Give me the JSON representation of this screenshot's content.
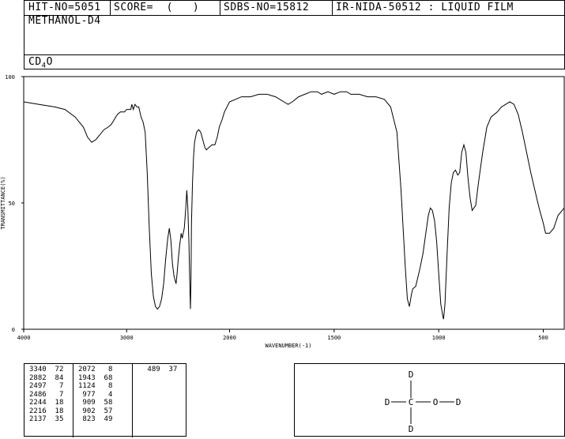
{
  "header": {
    "hit_no": "HIT-NO=5051",
    "score": "SCORE=  (   )",
    "sdbs_no": "SDBS-NO=15812",
    "method": "IR-NIDA-50512 : LIQUID FILM"
  },
  "compound": {
    "name": "METHANOL-D4",
    "formula_main": "CD",
    "formula_sub": "4",
    "formula_tail": "O"
  },
  "chart_data": {
    "type": "line",
    "title": "",
    "xlabel": "WAVENUMBER(-1)",
    "ylabel": "TRANSMITTANCE(%)",
    "xlim": [
      4000,
      400
    ],
    "ylim": [
      0,
      100
    ],
    "x_ticks": [
      4000,
      3000,
      2000,
      1500,
      1000,
      500
    ],
    "x_tick_labels": [
      "4000",
      "3000",
      "2000",
      "1500",
      "1000",
      "500"
    ],
    "y_ticks": [
      0,
      50,
      100
    ],
    "y_tick_labels": [
      "0",
      "50",
      "100"
    ],
    "series": [
      {
        "color": "#000000",
        "points": [
          [
            4000,
            90
          ],
          [
            3850,
            89
          ],
          [
            3700,
            88
          ],
          [
            3600,
            87
          ],
          [
            3500,
            84
          ],
          [
            3420,
            80
          ],
          [
            3380,
            76
          ],
          [
            3340,
            74
          ],
          [
            3300,
            75
          ],
          [
            3260,
            77
          ],
          [
            3220,
            79
          ],
          [
            3180,
            80
          ],
          [
            3150,
            81
          ],
          [
            3120,
            83
          ],
          [
            3090,
            85
          ],
          [
            3060,
            86
          ],
          [
            3020,
            86
          ],
          [
            3000,
            87
          ],
          [
            2960,
            87
          ],
          [
            2950,
            89
          ],
          [
            2935,
            87
          ],
          [
            2920,
            89
          ],
          [
            2900,
            88
          ],
          [
            2882,
            88
          ],
          [
            2860,
            84
          ],
          [
            2840,
            82
          ],
          [
            2820,
            78
          ],
          [
            2800,
            62
          ],
          [
            2780,
            40
          ],
          [
            2760,
            22
          ],
          [
            2740,
            13
          ],
          [
            2720,
            9
          ],
          [
            2700,
            8
          ],
          [
            2680,
            9
          ],
          [
            2660,
            12
          ],
          [
            2640,
            18
          ],
          [
            2620,
            28
          ],
          [
            2600,
            36
          ],
          [
            2585,
            40
          ],
          [
            2570,
            35
          ],
          [
            2555,
            26
          ],
          [
            2540,
            21
          ],
          [
            2520,
            18
          ],
          [
            2510,
            22
          ],
          [
            2500,
            27
          ],
          [
            2485,
            33
          ],
          [
            2470,
            38
          ],
          [
            2460,
            36
          ],
          [
            2440,
            40
          ],
          [
            2425,
            48
          ],
          [
            2415,
            55
          ],
          [
            2405,
            48
          ],
          [
            2395,
            34
          ],
          [
            2385,
            15
          ],
          [
            2380,
            8
          ],
          [
            2375,
            20
          ],
          [
            2370,
            42
          ],
          [
            2360,
            58
          ],
          [
            2350,
            68
          ],
          [
            2340,
            74
          ],
          [
            2320,
            78
          ],
          [
            2300,
            79
          ],
          [
            2280,
            78
          ],
          [
            2260,
            75
          ],
          [
            2240,
            72
          ],
          [
            2225,
            71
          ],
          [
            2200,
            72
          ],
          [
            2170,
            73
          ],
          [
            2143,
            73
          ],
          [
            2120,
            76
          ],
          [
            2100,
            80
          ],
          [
            2072,
            83
          ],
          [
            2050,
            86
          ],
          [
            2000,
            90
          ],
          [
            1943,
            92
          ],
          [
            1900,
            92
          ],
          [
            1860,
            93
          ],
          [
            1820,
            93
          ],
          [
            1780,
            92
          ],
          [
            1740,
            90
          ],
          [
            1720,
            89
          ],
          [
            1700,
            90
          ],
          [
            1670,
            92
          ],
          [
            1640,
            93
          ],
          [
            1610,
            94
          ],
          [
            1580,
            94
          ],
          [
            1560,
            93
          ],
          [
            1530,
            94
          ],
          [
            1500,
            93
          ],
          [
            1470,
            94
          ],
          [
            1440,
            94
          ],
          [
            1420,
            93
          ],
          [
            1400,
            93
          ],
          [
            1380,
            93
          ],
          [
            1340,
            92
          ],
          [
            1300,
            92
          ],
          [
            1260,
            91
          ],
          [
            1230,
            88
          ],
          [
            1200,
            78
          ],
          [
            1180,
            55
          ],
          [
            1160,
            25
          ],
          [
            1150,
            12
          ],
          [
            1140,
            9
          ],
          [
            1130,
            14
          ],
          [
            1124,
            16
          ],
          [
            1110,
            17
          ],
          [
            1090,
            24
          ],
          [
            1075,
            30
          ],
          [
            1060,
            39
          ],
          [
            1050,
            45
          ],
          [
            1040,
            48
          ],
          [
            1030,
            47
          ],
          [
            1020,
            43
          ],
          [
            1010,
            35
          ],
          [
            1000,
            22
          ],
          [
            990,
            10
          ],
          [
            980,
            5
          ],
          [
            977,
            4
          ],
          [
            970,
            10
          ],
          [
            960,
            30
          ],
          [
            950,
            48
          ],
          [
            940,
            58
          ],
          [
            930,
            62
          ],
          [
            920,
            63
          ],
          [
            909,
            61
          ],
          [
            900,
            62
          ],
          [
            890,
            70
          ],
          [
            880,
            73
          ],
          [
            870,
            70
          ],
          [
            860,
            60
          ],
          [
            850,
            52
          ],
          [
            840,
            47
          ],
          [
            823,
            49
          ],
          [
            810,
            58
          ],
          [
            790,
            70
          ],
          [
            770,
            80
          ],
          [
            750,
            84
          ],
          [
            720,
            86
          ],
          [
            700,
            88
          ],
          [
            680,
            89
          ],
          [
            660,
            90
          ],
          [
            640,
            89
          ],
          [
            620,
            85
          ],
          [
            600,
            78
          ],
          [
            580,
            70
          ],
          [
            560,
            62
          ],
          [
            540,
            55
          ],
          [
            520,
            48
          ],
          [
            500,
            42
          ],
          [
            489,
            38
          ],
          [
            470,
            38
          ],
          [
            450,
            40
          ],
          [
            430,
            45
          ],
          [
            400,
            48
          ]
        ]
      }
    ]
  },
  "peak_table": {
    "columns": [
      [
        [
          "3340",
          "72"
        ],
        [
          "2882",
          "84"
        ],
        [
          "2497",
          "7"
        ],
        [
          "2486",
          "7"
        ],
        [
          "2244",
          "18"
        ],
        [
          "2216",
          "18"
        ],
        [
          "2137",
          "35"
        ]
      ],
      [
        [
          "2072",
          "8"
        ],
        [
          "1943",
          "68"
        ],
        [
          "1124",
          "8"
        ],
        [
          "977",
          "4"
        ],
        [
          "909",
          "58"
        ],
        [
          "902",
          "57"
        ],
        [
          "823",
          "49"
        ]
      ],
      [
        [
          "489",
          "37"
        ]
      ]
    ]
  },
  "structure": {
    "atoms": [
      "D",
      "D",
      "C",
      "O",
      "D",
      "D"
    ]
  }
}
